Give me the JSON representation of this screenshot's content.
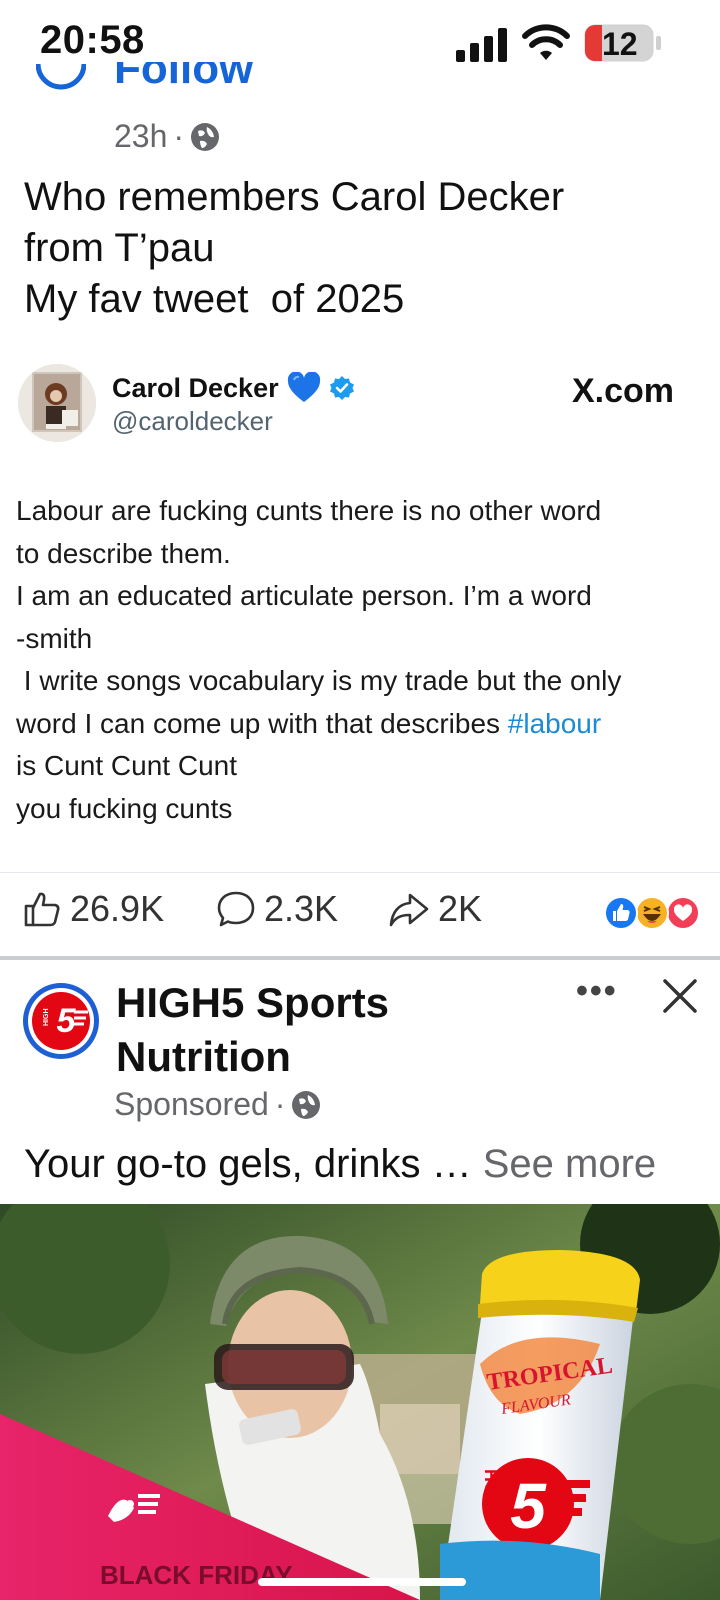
{
  "status_bar": {
    "time": "20:58",
    "battery_level": "12",
    "icons": [
      "cellular-signal-icon",
      "wifi-icon",
      "battery-icon"
    ]
  },
  "post": {
    "follow_label": "Follow",
    "time": "23h",
    "separator": "·",
    "audience_icon": "globe-icon",
    "text_lines": [
      "Who remembers Carol Decker",
      "from T’pau",
      "My fav tweet  of 2025"
    ]
  },
  "tweet": {
    "name": "Carol Decker",
    "handle": "@caroldecker",
    "source": "X.com",
    "emoji": "blue-heart-icon",
    "verified": "verified-badge-icon",
    "body_lines": [
      "Labour are fucking cunts there is no other word",
      "to describe them.",
      "I am an educated articulate person. I’m a word",
      "-smith",
      " I write songs vocabulary is my trade but the only",
      "word I can come up with that describes ",
      "is Cunt Cunt Cunt",
      "you fucking cunts"
    ],
    "hashtag": "#labour"
  },
  "reactions": {
    "likes": "26.9K",
    "comments": "2.3K",
    "shares": "2K",
    "reaction_icons": [
      "like-reaction-icon",
      "haha-reaction-icon",
      "love-reaction-icon"
    ]
  },
  "ad": {
    "name_lines": [
      "HIGH5 Sports",
      "Nutrition"
    ],
    "sponsored_label": "Sponsored",
    "separator": "·",
    "text": "Your go-to gels, drinks … ",
    "see_more": "See more",
    "more_label": "•••",
    "banner_text": "BLACK FRIDAY",
    "product_label_line1": "TROPICAL",
    "product_label_line2": "FLAVOUR",
    "brand_mark": "HIGH",
    "colors": {
      "brand_red": "#e30613",
      "banner_pink": "#e11f5a",
      "tube_yellow": "#f6d21b",
      "link_blue": "#1d8ad6",
      "follow_blue": "#1565d8"
    }
  }
}
